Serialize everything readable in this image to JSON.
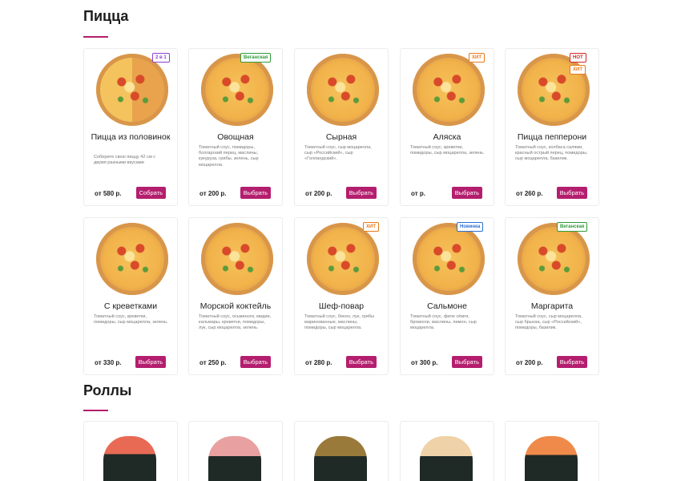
{
  "sections": {
    "pizza": {
      "title": "Пицца"
    },
    "rolls": {
      "title": "Роллы"
    }
  },
  "accent_color": "#b41e6e",
  "pizzas": [
    {
      "name": "Пицца из половинок",
      "desc": "Соберите свою пиццу 42 см с двумя разными вкусами",
      "price": "от 580 р.",
      "button": "Собрать",
      "badges": [
        "2 в 1"
      ]
    },
    {
      "name": "Овощная",
      "desc": "Томатный соус, помидоры, болгарский перец, маслины, кукуруза, грибы, зелень, сыр моцарелла.",
      "price": "от 200 р.",
      "button": "Выбрать",
      "badges": [
        "Веганская"
      ]
    },
    {
      "name": "Сырная",
      "desc": "Томатный соус, сыр моцарелла, сыр «Российский», сыр «Голландский».",
      "price": "от 200 р.",
      "button": "Выбрать",
      "badges": []
    },
    {
      "name": "Аляска",
      "desc": "Томатный соус, креветки, помидоры, сыр моцарелла, зелень.",
      "price": "от р.",
      "button": "Выбрать",
      "badges": [
        "ХИТ"
      ]
    },
    {
      "name": "Пицца пепперони",
      "desc": "Томатный соус, колбаса салями, красный острый перец, помидоры, сыр моцарелла, базилик.",
      "price": "от 260 р.",
      "button": "Выбрать",
      "badges": [
        "HOT",
        "ХИТ"
      ]
    },
    {
      "name": "С креветками",
      "desc": "Томатный соус, креветки, помидоры, сыр моцарелла, зелень.",
      "price": "от 330 р.",
      "button": "Выбрать",
      "badges": []
    },
    {
      "name": "Морской коктейль",
      "desc": "Томатный соус, осьминоги, мидии, кальмары, креветки, помидоры, лук, сыр моцарелла, зелень.",
      "price": "от 250 р.",
      "button": "Выбрать",
      "badges": []
    },
    {
      "name": "Шеф-повар",
      "desc": "Томатный соус, бекон, лук, грибы маринованные, маслины, помидоры, сыр моцарелла.",
      "price": "от 280 р.",
      "button": "Выбрать",
      "badges": [
        "ХИТ"
      ]
    },
    {
      "name": "Сальмоне",
      "desc": "Томатный соус, филе сёмги, брокколи, маслины, лимон, сыр моцарелла.",
      "price": "от 300 р.",
      "button": "Выбрать",
      "badges": [
        "Новинка"
      ]
    },
    {
      "name": "Маргарита",
      "desc": "Томатный соус, сыр моцарелла, сыр брынза, сыр «Российский», помидоры, базилик.",
      "price": "от 200 р.",
      "button": "Выбрать",
      "badges": [
        "Веганская"
      ]
    }
  ]
}
